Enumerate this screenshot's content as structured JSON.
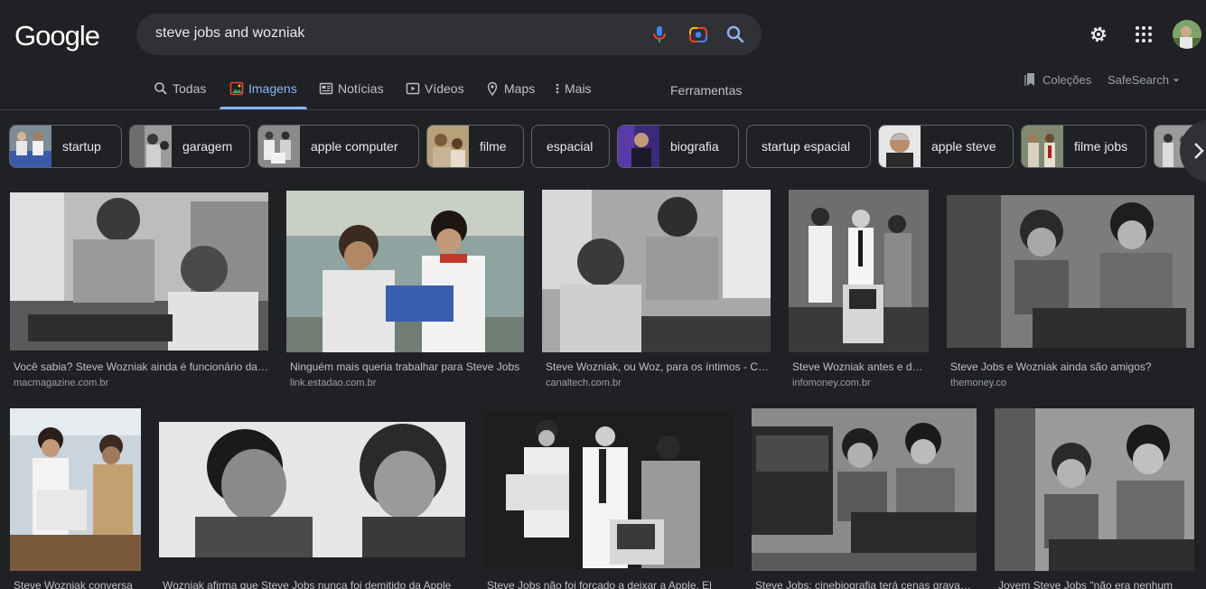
{
  "logo": "Google",
  "search": {
    "query": "steve jobs and wozniak"
  },
  "tabs": [
    {
      "label": "Todas",
      "icon": "search-icon"
    },
    {
      "label": "Imagens",
      "icon": "images-icon",
      "active": true
    },
    {
      "label": "Notícias",
      "icon": "news-icon"
    },
    {
      "label": "Vídeos",
      "icon": "video-icon"
    },
    {
      "label": "Maps",
      "icon": "map-pin-icon"
    },
    {
      "label": "Mais",
      "icon": "more-vert-icon"
    }
  ],
  "tools_label": "Ferramentas",
  "colecoes_label": "Coleções",
  "safesearch_label": "SafeSearch",
  "chips": [
    {
      "label": "startup"
    },
    {
      "label": "garagem"
    },
    {
      "label": "apple computer"
    },
    {
      "label": "filme"
    },
    {
      "label": "espacial"
    },
    {
      "label": "biografia"
    },
    {
      "label": "startup espacial"
    },
    {
      "label": "apple steve"
    },
    {
      "label": "filme jobs"
    }
  ],
  "results": [
    {
      "title": "Você sabia? Steve Wozniak ainda é funcionário da Apple",
      "source": "macmagazine.com.br"
    },
    {
      "title": "Ninguém mais queria trabalhar para Steve Jobs",
      "source": "link.estadao.com.br"
    },
    {
      "title": "Steve Wozniak, ou Woz, para os íntimos - Canaltech",
      "source": "canaltech.com.br"
    },
    {
      "title": "Steve Wozniak antes e depois",
      "source": "infomoney.com.br"
    },
    {
      "title": "Steve Jobs e Wozniak ainda são amigos?",
      "source": "themoney.co"
    },
    {
      "title": "Steve Wozniak conversa",
      "source": ""
    },
    {
      "title": "Wozniak afirma que Steve Jobs nunca foi demitido da Apple",
      "source": ""
    },
    {
      "title": "Steve Jobs não foi forçado a deixar a Apple, El",
      "source": ""
    },
    {
      "title": "Steve Jobs: cinebiografia terá cenas gravadas",
      "source": ""
    },
    {
      "title": "Jovem Steve Jobs \"não era nenhum",
      "source": ""
    }
  ],
  "colors": {
    "background": "#202124",
    "accent": "#8ab4f8",
    "searchbar": "#303134"
  }
}
